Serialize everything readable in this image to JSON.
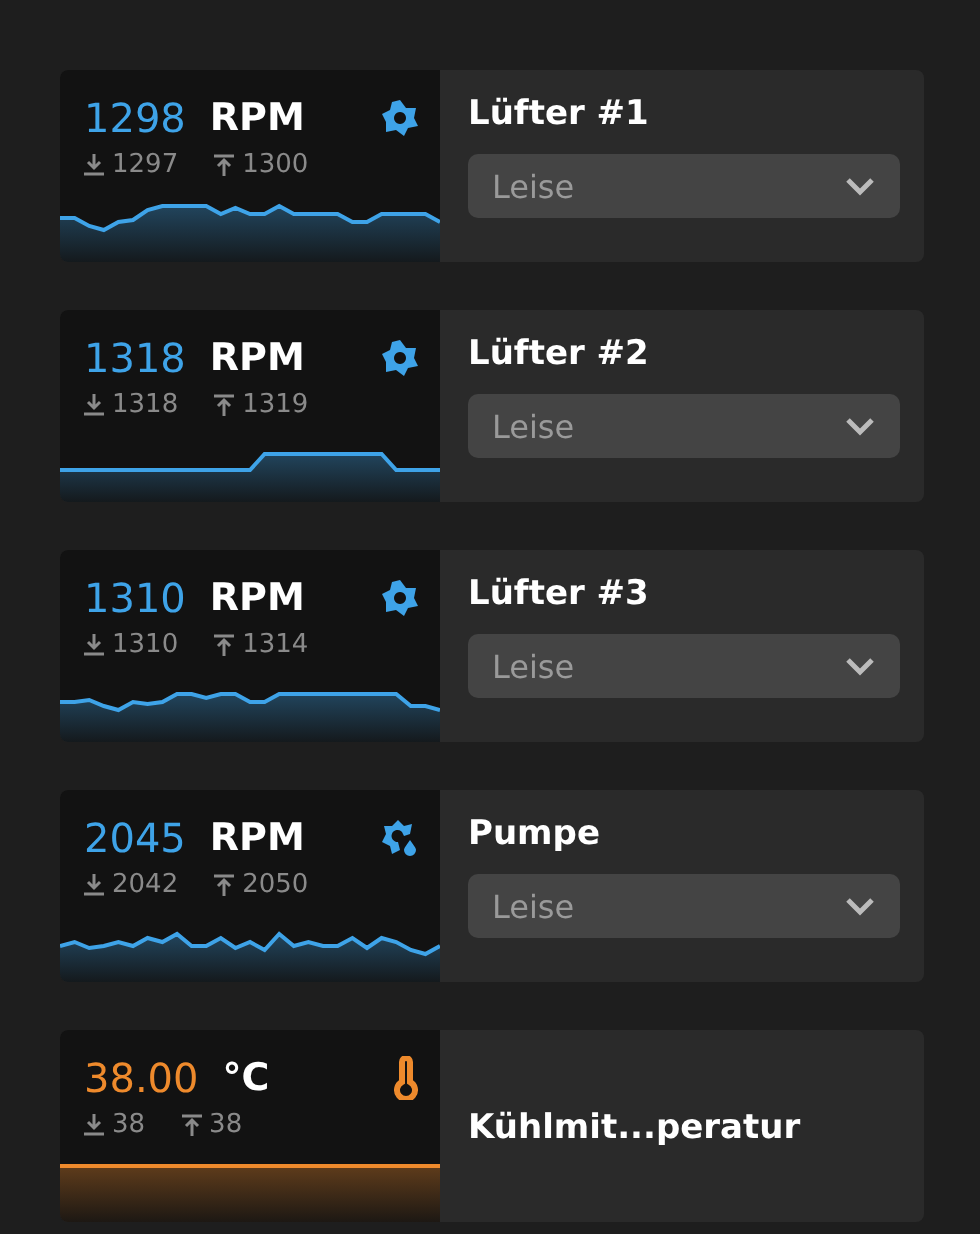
{
  "sensors": [
    {
      "kind": "fan",
      "value": "1298",
      "unit": "RPM",
      "min": "1297",
      "max": "1300",
      "name": "Lüfter #1",
      "mode": "Leise"
    },
    {
      "kind": "fan",
      "value": "1318",
      "unit": "RPM",
      "min": "1318",
      "max": "1319",
      "name": "Lüfter #2",
      "mode": "Leise"
    },
    {
      "kind": "fan",
      "value": "1310",
      "unit": "RPM",
      "min": "1310",
      "max": "1314",
      "name": "Lüfter #3",
      "mode": "Leise"
    },
    {
      "kind": "pump",
      "value": "2045",
      "unit": "RPM",
      "min": "2042",
      "max": "2050",
      "name": "Pumpe",
      "mode": "Leise"
    },
    {
      "kind": "temperature",
      "value": "38.00",
      "unit": "°C",
      "min": "38",
      "max": "38",
      "name": "Kühlmit...peratur"
    }
  ]
}
